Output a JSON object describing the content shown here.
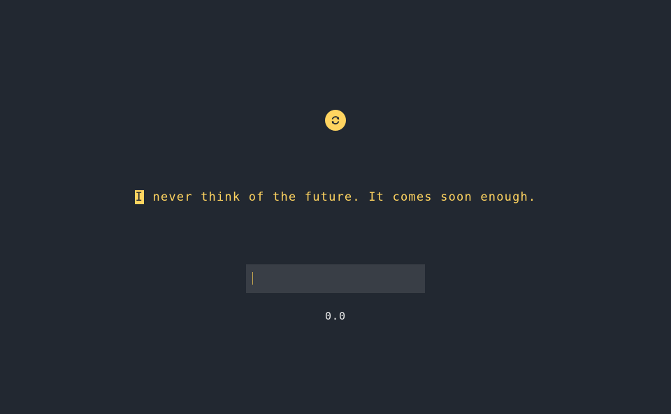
{
  "refresh": {
    "icon": "refresh-icon",
    "color": "#ffd460"
  },
  "quote": {
    "current_char": "I",
    "rest": " never think of the future. It comes soon enough."
  },
  "input": {
    "value": "",
    "placeholder": ""
  },
  "score": "0.0",
  "colors": {
    "background": "#222831",
    "accent": "#ffd460",
    "input_background": "#393e46",
    "text": "#eeeeee"
  }
}
